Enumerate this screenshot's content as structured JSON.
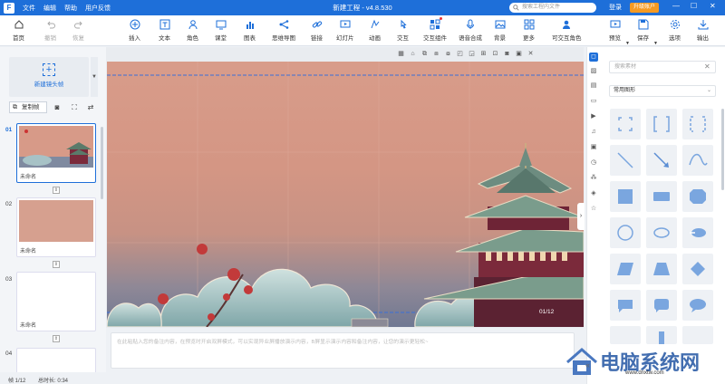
{
  "app": {
    "title": "新建工程 - v4.8.530",
    "menu": [
      "文件",
      "编辑",
      "帮助",
      "用户反馈"
    ],
    "search_placeholder": "搜索工程内文件",
    "login": "登录",
    "upgrade": "升级账户"
  },
  "toolbar": {
    "left": [
      {
        "label": "首页",
        "icon": "home-icon"
      },
      {
        "label": "撤销",
        "icon": "undo-icon",
        "disabled": true
      },
      {
        "label": "恢复",
        "icon": "redo-icon",
        "disabled": true
      }
    ],
    "main": [
      {
        "label": "插入",
        "icon": "insert-icon"
      },
      {
        "label": "文本",
        "icon": "text-icon"
      },
      {
        "label": "角色",
        "icon": "character-icon"
      },
      {
        "label": "课堂",
        "icon": "classroom-icon"
      },
      {
        "label": "图表",
        "icon": "chart-icon"
      },
      {
        "label": "思维导图",
        "icon": "mindmap-icon"
      },
      {
        "label": "链接",
        "icon": "link-icon"
      },
      {
        "label": "幻灯片",
        "icon": "slides-icon"
      },
      {
        "label": "动画",
        "icon": "animation-icon"
      },
      {
        "label": "交互",
        "icon": "interact-icon"
      },
      {
        "label": "交互组件",
        "icon": "interactive-component-icon"
      },
      {
        "label": "语音合成",
        "icon": "speech-synthesis-icon"
      },
      {
        "label": "背景",
        "icon": "background-icon"
      },
      {
        "label": "更多",
        "icon": "more-icon"
      },
      {
        "label": "可交互角色",
        "icon": "interactive-character-icon"
      }
    ],
    "right": [
      {
        "label": "预览",
        "icon": "preview-icon"
      },
      {
        "label": "保存",
        "icon": "save-icon"
      },
      {
        "label": "选项",
        "icon": "options-icon"
      },
      {
        "label": "输出",
        "icon": "export-icon"
      }
    ]
  },
  "left_panel": {
    "new_frame": "新建镜头帧",
    "copy_frame": "复制帧",
    "frames": [
      {
        "num": "01",
        "name": "未命名",
        "active": true
      },
      {
        "num": "02",
        "name": "未命名",
        "active": false
      },
      {
        "num": "03",
        "name": "未命名",
        "active": false
      },
      {
        "num": "04",
        "name": "",
        "active": false
      }
    ]
  },
  "canvas": {
    "page_indicator": "01/12",
    "notes_placeholder": "在此粘贴入您的备注内容，在预览时开启双屏模式，可以实现异业屏播放演示内容，B屏显示演示内容和备注内容，让您的演示更轻松~"
  },
  "status": {
    "frame": "帧 1/12",
    "duration": "总时长: 0:34"
  },
  "right_panel": {
    "search_placeholder": "搜索素材",
    "category": "常用图形",
    "shape_color": "#7aa6df"
  },
  "watermark": {
    "text": "电脑系统网",
    "url": "www.dnxtw.com"
  },
  "colors": {
    "accent": "#1e6fd9",
    "upgrade": "#f59a23"
  }
}
